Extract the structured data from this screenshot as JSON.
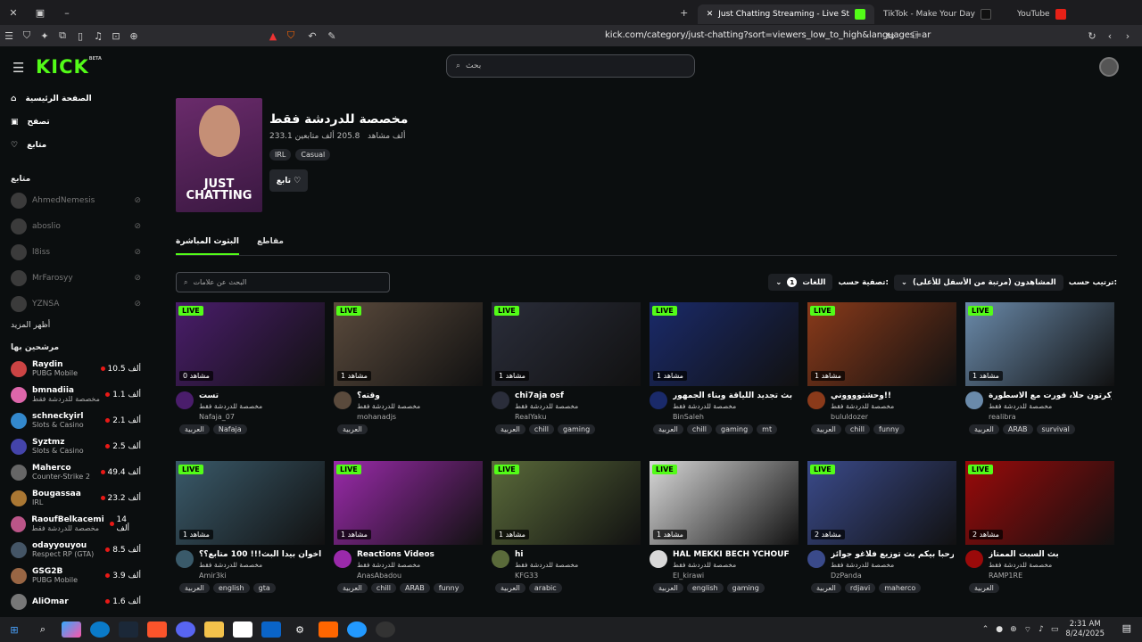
{
  "browser": {
    "tabs": [
      {
        "label": "Just Chatting Streaming - Live St",
        "active": true
      },
      {
        "label": "TikTok - Make Your Day",
        "active": false
      },
      {
        "label": "YouTube",
        "active": false
      }
    ],
    "url": "kick.com/category/just-chatting?sort=viewers_low_to_high&languages=ar"
  },
  "header": {
    "logo": "KICK",
    "logo_sup": "BETA",
    "search_placeholder": "بحث"
  },
  "sidebar": {
    "nav": [
      {
        "label": "الصفحة الرئيسية",
        "icon": "home-icon"
      },
      {
        "label": "تصفح",
        "icon": "browse-icon"
      },
      {
        "label": "متابع",
        "icon": "heart-icon"
      }
    ],
    "following_title": "متابع",
    "following": [
      "AhmedNemesis",
      "aboslio",
      "l8iss",
      "MrFarosyy",
      "YZNSA"
    ],
    "show_more": "أظهر المزيد",
    "recommended_title": "مرشحين بها",
    "recommended": [
      {
        "name": "Raydin",
        "game": "PUBG Mobile",
        "viewers": "10.5 ألف"
      },
      {
        "name": "bmnadiia",
        "game": "مخصصة للدردشة فقط",
        "viewers": "1.1 ألف"
      },
      {
        "name": "schneckyirl",
        "game": "Slots & Casino",
        "viewers": "2.1 ألف"
      },
      {
        "name": "Syztmz",
        "game": "Slots & Casino",
        "viewers": "2.5 ألف"
      },
      {
        "name": "Maherco",
        "game": "Counter-Strike 2",
        "viewers": "49.4 ألف"
      },
      {
        "name": "Bougassaa",
        "game": "IRL",
        "viewers": "23.2 ألف"
      },
      {
        "name": "RaoufBelkacemi",
        "game": "مخصصة للدردشة فقط",
        "viewers": "14 ألف"
      },
      {
        "name": "odayyouyou",
        "game": "Respect RP (GTA)",
        "viewers": "8.5 ألف"
      },
      {
        "name": "GSG2B",
        "game": "PUBG Mobile",
        "viewers": "3.9 ألف"
      },
      {
        "name": "AliOmar",
        "game": "",
        "viewers": "1.6 ألف"
      }
    ]
  },
  "category": {
    "title": "مخصصة للدردشة فقط",
    "followers": "205.8 ألف متابعين",
    "viewers": "233.1 ألف مشاهد",
    "tags": [
      "IRL",
      "Casual"
    ],
    "follow_label": "تابع",
    "cover_text": "JUST CHATTING"
  },
  "page_tabs": {
    "live": "البثوث المباشرة",
    "clips": "مقاطع"
  },
  "tag_search_placeholder": "البحث عن علامات",
  "filters": {
    "sort_label": "ترتيب حسب:",
    "sort_value": "المشاهدون (مرتبة من الأسفل للأعلى)",
    "filter_label": "تصفية حسب:",
    "lang_label": "اللغات",
    "lang_count": "1"
  },
  "live_badge": "LIVE",
  "streams": [
    {
      "title": "تست",
      "category": "مخصصة للدردشة فقط",
      "streamer": "Nafaja_07",
      "tags": [
        "العربية",
        "Nafaja"
      ],
      "views": "0 مشاهد",
      "color": "#4a1d6b"
    },
    {
      "title": "وقته؟",
      "category": "مخصصة للدردشة فقط",
      "streamer": "mohanadjs",
      "tags": [
        "العربية"
      ],
      "views": "1 مشاهد",
      "color": "#5a4a3c"
    },
    {
      "title": "chi7aja osf",
      "category": "مخصصة للدردشة فقط",
      "streamer": "RealYaku",
      "tags": [
        "العربية",
        "chill",
        "gaming"
      ],
      "views": "1 مشاهد",
      "color": "#2a2d3a"
    },
    {
      "title": "بث تجديد اللياقة وبناء الجمهور",
      "category": "مخصصة للدردشة فقط",
      "streamer": "BinSaleh",
      "tags": [
        "العربية",
        "chill",
        "gaming",
        "mt"
      ],
      "views": "1 مشاهد",
      "color": "#1a2a6a"
    },
    {
      "title": "وحشتووووني!!",
      "category": "مخصصة للدردشة فقط",
      "streamer": "bululdozer",
      "tags": [
        "العربية",
        "chill",
        "funny"
      ],
      "views": "1 مشاهد",
      "color": "#8a3a1a"
    },
    {
      "title": "هلا وكرتون حلا، فورت مع الاسطورة",
      "category": "مخصصة للدردشة فقط",
      "streamer": "realibra",
      "tags": [
        "العربية",
        "ARAB",
        "survival"
      ],
      "views": "1 مشاهد",
      "color": "#6a8aaa"
    },
    {
      "title": "يا اخوان بيدا البث!!! 100 متابع؟؟",
      "category": "مخصصة للدردشة فقط",
      "streamer": "Amir3ki",
      "tags": [
        "العربية",
        "english",
        "gta"
      ],
      "views": "1 مشاهد",
      "color": "#3a5a6a"
    },
    {
      "title": "Reactions Videos",
      "category": "مخصصة للدردشة فقط",
      "streamer": "AnasAbadou",
      "tags": [
        "العربية",
        "chill",
        "ARAB",
        "funny"
      ],
      "views": "1 مشاهد",
      "color": "#9a2aaa"
    },
    {
      "title": "hi",
      "category": "مخصصة للدردشة فقط",
      "streamer": "KFG33",
      "tags": [
        "العربية",
        "arabic"
      ],
      "views": "1 مشاهد",
      "color": "#5a6a3a"
    },
    {
      "title": "HAL MEKKI BECH YCHOUF",
      "category": "مخصصة للدردشة فقط",
      "streamer": "El_kirawi",
      "tags": [
        "العربية",
        "english",
        "gaming"
      ],
      "views": "1 مشاهد",
      "color": "#d8d8d8"
    },
    {
      "title": "مرحبا بيكم بث توزيع فلاغو جوائز",
      "category": "مخصصة للدردشة فقط",
      "streamer": "DzPanda",
      "tags": [
        "العربية",
        "rdjavi",
        "maherco"
      ],
      "views": "2 مشاهد",
      "color": "#3a4a8a"
    },
    {
      "title": "بث السبت الممتاز",
      "category": "مخصصة للدردشة فقط",
      "streamer": "RAMP1RE",
      "tags": [
        "العربية"
      ],
      "views": "2 مشاهد",
      "color": "#9a0a0a"
    }
  ],
  "taskbar": {
    "time": "2:31 AM",
    "date": "8/24/2025"
  }
}
